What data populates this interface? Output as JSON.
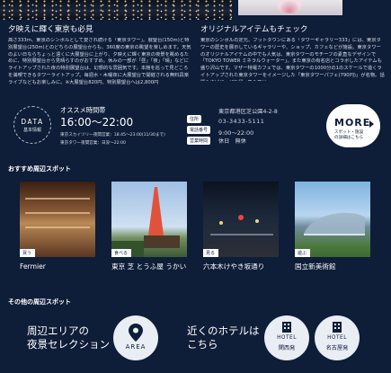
{
  "intro": {
    "left_heading": "夕映えに輝く東京も必見",
    "left_text": "高さ333m、東京のシンボルとして愛され続ける「東京タワー」。展望台(150m)と特別展望台(250m)とのどちらの展望台からも、360度の東京の眺望を楽しめます。天気のよい日ならちょっと遠くに大展望台に上がり、夕映えに輝く東京の夜景を眺めるために、特別展望台から見晴らすのがおすすめ。休みの一部が「昼」「夜」「晴」などにライトアップされた夜の特別展望台は、幻想的な雰囲気です。本館を巡って見どころを満喫できるタワーライトアップ。毎週水・木曜夜に大展望台で開催される無料具楽ライブなどもお楽しみに。※大展望台820円、特別展望台へは2,800円",
    "right_heading": "オリジナルアイテムもチェック",
    "right_text": "東京のシンボルの定元、フットタウンにある「タワーギャラリー333」には、東京タワーの歴史を展示しているギャラリーや、ショップ、カフェなどが施設。東京タワーのオリジナルアイテムの中でも人気は、東京タワーのモチーフの素直なデザインで「TOKYO TOWER ミネラルウォーター」。また東京の有名店とコラボしたアイテムも盛り沢山です。マザー特電カフェでは、東京タワーの1000分の1のスケールで造くライトアップされた東京タワーをイメージした「東京タワーパフェ(790円)」が名物。話題みやげに、ぜひ帰ってみては。"
  },
  "data_badge": {
    "line1": "DATA",
    "line2": "基本情報"
  },
  "hours": {
    "label": "オススメ時間帯",
    "value": "16:00～22:00",
    "note1": "東京スカイツリー夜間営業：18:45～23:00(11/30まで)",
    "note2": "東京タワー夜間営業：日没～22:00"
  },
  "info": {
    "address_label": "住所",
    "address": "東京都港区芝公園4-2-8",
    "phone_label": "電話番号",
    "phone": "03-3433-5111",
    "hours_label": "営業時間",
    "hours": "9:00～22:00",
    "closed": "休日　無休"
  },
  "more_button": {
    "label": "MORE",
    "sub": "スポット・施設の詳細はこちら"
  },
  "nearby": {
    "title": "おすすめ周辺スポット",
    "spots": [
      {
        "badge": "買う",
        "name": "Fermier"
      },
      {
        "badge": "食べる",
        "name": "東京 芝 とうふ屋 うかい"
      },
      {
        "badge": "見る",
        "name": "六本木けやき坂通り"
      },
      {
        "badge": "遊ぶ",
        "name": "国立新美術館"
      }
    ]
  },
  "other": {
    "title": "その他の周辺スポット",
    "area_text_line1": "周辺エリアの",
    "area_text_line2": "夜景セレクション",
    "area_button": "AREA",
    "hotel_text_line1": "近くのホテルは",
    "hotel_text_line2": "こちら",
    "hotel1_line1": "HOTEL",
    "hotel1_line2": "関西発",
    "hotel2_line1": "HOTEL",
    "hotel2_line2": "名古屋発"
  },
  "colors": {
    "background": "#0e1d38",
    "text": "#ffffff",
    "button": "#e9edf4"
  }
}
